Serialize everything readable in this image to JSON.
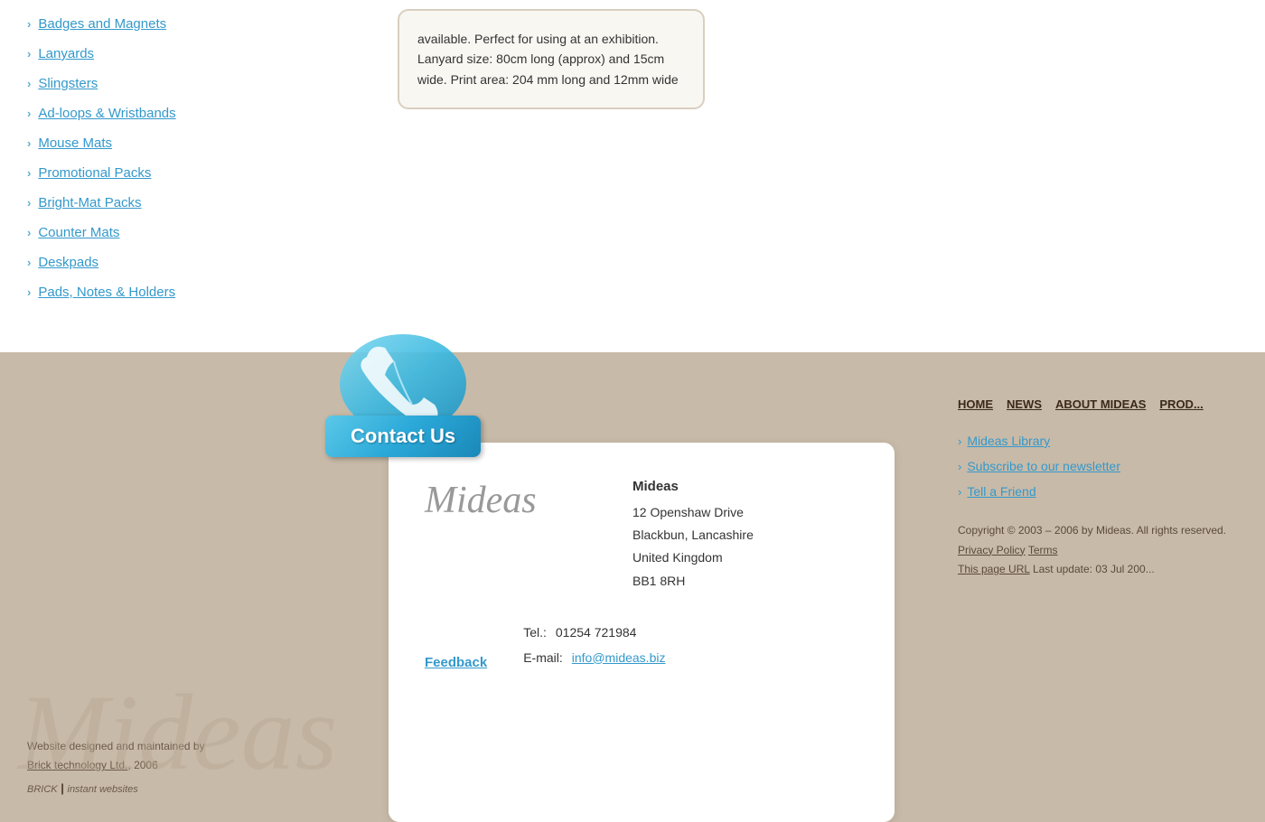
{
  "nav": {
    "items": [
      {
        "label": "Badges and Magnets",
        "href": "#"
      },
      {
        "label": "Lanyards",
        "href": "#"
      },
      {
        "label": "Slingsters",
        "href": "#"
      },
      {
        "label": "Ad-loops & Wristbands",
        "href": "#"
      },
      {
        "label": "Mouse Mats",
        "href": "#"
      },
      {
        "label": "Promotional Packs",
        "href": "#"
      },
      {
        "label": "Bright-Mat Packs",
        "href": "#"
      },
      {
        "label": "Counter Mats",
        "href": "#"
      },
      {
        "label": "Deskpads",
        "href": "#"
      },
      {
        "label": "Pads, Notes & Holders",
        "href": "#"
      }
    ]
  },
  "info_box": {
    "text": "available. Perfect for using at an exhibition. Lanyard size: 80cm long (approx) and 15cm wide. Print area: 204 mm long and 12mm wide"
  },
  "contact_button": {
    "label": "Contact Us"
  },
  "contact_card": {
    "logo": "Mideas",
    "company_name": "Mideas",
    "address_line1": "12 Openshaw Drive",
    "address_line2": "Blackbun, Lancashire",
    "address_line3": "United Kingdom",
    "address_line4": "BB1 8RH",
    "tel_label": "Tel.:",
    "tel_number": "01254 721984",
    "email_label": "E-mail:",
    "email": "info@mideas.biz",
    "feedback_label": "Feedback"
  },
  "footer": {
    "nav_items": [
      {
        "label": "HOME"
      },
      {
        "label": "NEWS"
      },
      {
        "label": "ABOUT MIDEAS"
      },
      {
        "label": "PROD..."
      }
    ],
    "links": [
      {
        "label": "Mideas Library"
      },
      {
        "label": "Subscribe to our newsletter"
      },
      {
        "label": "Tell a Friend"
      }
    ],
    "copyright": "Copyright © 2003 – 2006 by Mideas. All rights reserved.",
    "privacy_policy": "Privacy Policy",
    "terms": "Terms",
    "page_url": "This page URL",
    "last_update": "Last update: 03 Jul 200..."
  },
  "website_credit": {
    "text": "Website designed and maintained by",
    "link_text": "Brick technology Ltd.",
    "year": ", 2006",
    "brand": "BRICK",
    "brand_tagline": "instant websites"
  }
}
